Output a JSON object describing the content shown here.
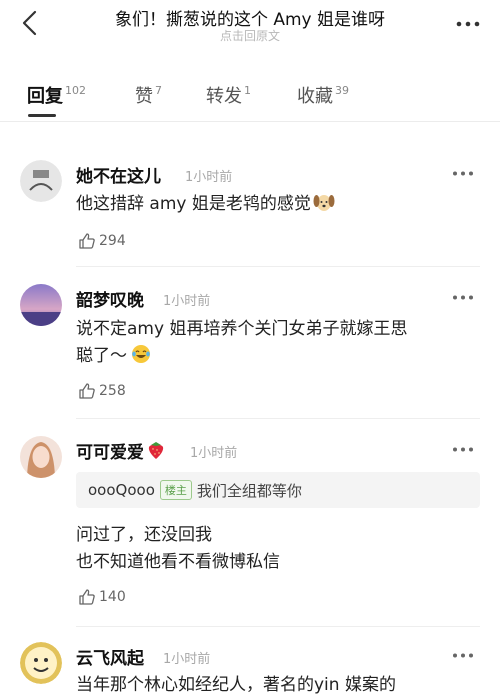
{
  "header": {
    "title": "象们！撕葱说的这个 Amy 姐是谁呀",
    "subtitle": "点击回原文"
  },
  "tabs": [
    {
      "label": "回复",
      "count": "102",
      "active": true
    },
    {
      "label": "赞",
      "count": "7",
      "active": false
    },
    {
      "label": "转发",
      "count": "1",
      "active": false
    },
    {
      "label": "收藏",
      "count": "39",
      "active": false
    }
  ],
  "comments": [
    {
      "name": "她不在这儿",
      "time": "1小时前",
      "lines": [
        "他这措辞 amy 姐是老鸨的感觉"
      ],
      "emoji": "dog-face",
      "likes": "294"
    },
    {
      "name": "韶梦叹晚",
      "time": "1小时前",
      "lines": [
        "说不定amy 姐再培养个关门女弟子就嫁王思",
        "聪了～"
      ],
      "emoji": "laughing-tears",
      "likes": "258"
    },
    {
      "name": "可可爱爱",
      "name_emoji": "strawberry",
      "time": "1小时前",
      "quote": {
        "user": "oooQooo",
        "badge": "楼主",
        "text": "我们全组都等你"
      },
      "lines": [
        "问过了，还没回我",
        "也不知道他看不看微博私信"
      ],
      "likes": "140"
    },
    {
      "name": "云飞风起",
      "time": "1小时前",
      "lines": [
        "当年那个林心如经纪人，著名的yin 媒案的"
      ]
    }
  ]
}
